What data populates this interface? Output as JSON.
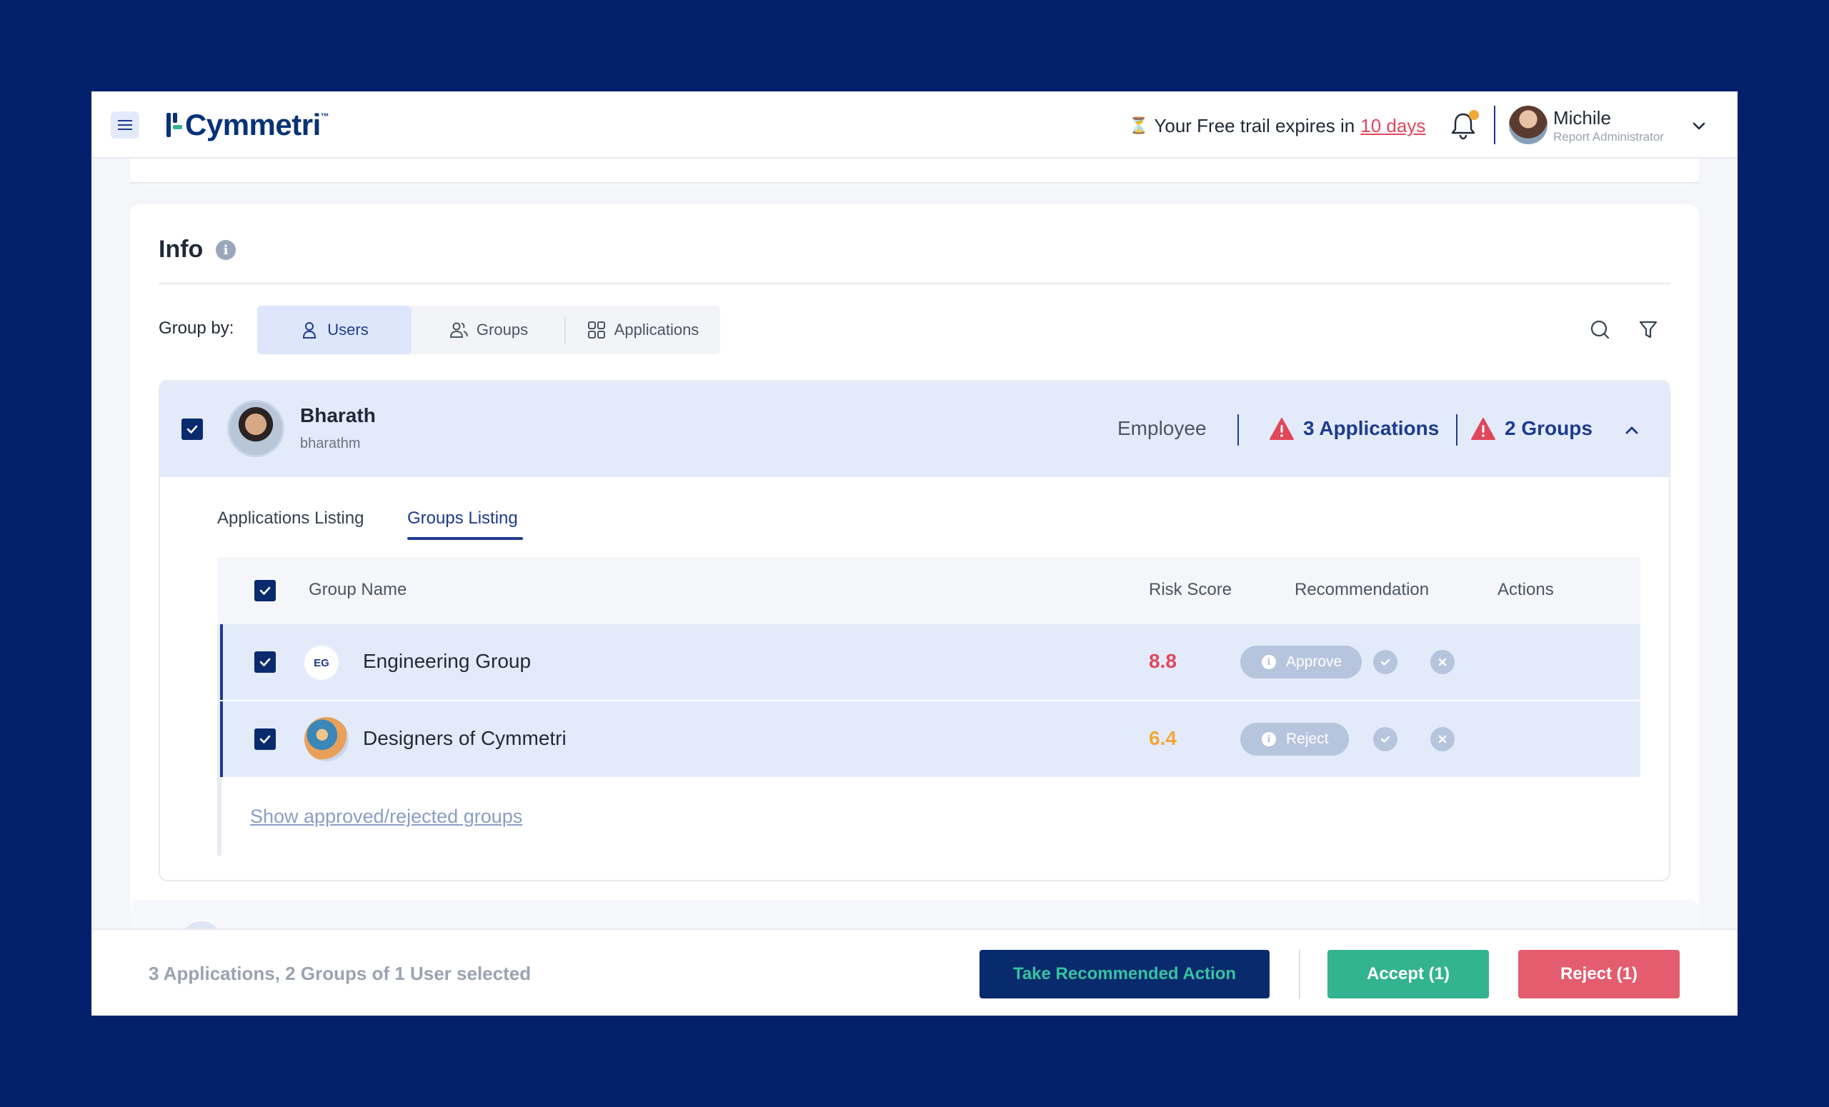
{
  "header": {
    "logo_text": "Cymmetri",
    "logo_tm": "™",
    "trial_prefix": "Your Free trail expires in",
    "trial_days": "10 days",
    "hourglass": "⏳",
    "user_name": "Michile",
    "user_role": "Report Administrator",
    "notification_dot_color": "#f2a735"
  },
  "info": {
    "title": "Info",
    "info_glyph": "i",
    "group_by_label": "Group by:",
    "group_by_options": [
      "Users",
      "Groups",
      "Applications"
    ],
    "group_by_selected": "Users"
  },
  "user": {
    "name": "Bharath",
    "handle": "bharathm",
    "role": "Employee",
    "applications_count": "3 Applications",
    "groups_count": "2 Groups",
    "tabs": [
      "Applications Listing",
      "Groups Listing"
    ],
    "active_tab": "Groups Listing"
  },
  "table": {
    "headers": {
      "name": "Group Name",
      "risk": "Risk Score",
      "recommendation": "Recommendation",
      "actions": "Actions"
    },
    "rows": [
      {
        "badge": "EG",
        "name": "Engineering Group",
        "risk": "8.8",
        "risk_color": "#e0475a",
        "recommendation": "Approve"
      },
      {
        "badge": "",
        "name": "Designers of Cymmetri",
        "risk": "6.4",
        "risk_color": "#f2a735",
        "recommendation": "Reject"
      }
    ],
    "show_link": "Show approved/rejected groups"
  },
  "footer": {
    "selection_text": "3 Applications, 2 Groups of 1 User selected",
    "take_action_label": "Take Recommended Action",
    "accept_label": "Accept (1)",
    "reject_label": "Reject (1)"
  },
  "colors": {
    "background": "#02206b",
    "primary": "#1d3b8f",
    "accept": "#33b38f",
    "reject": "#e35d6f",
    "highlight_row": "#e3ebfb"
  }
}
